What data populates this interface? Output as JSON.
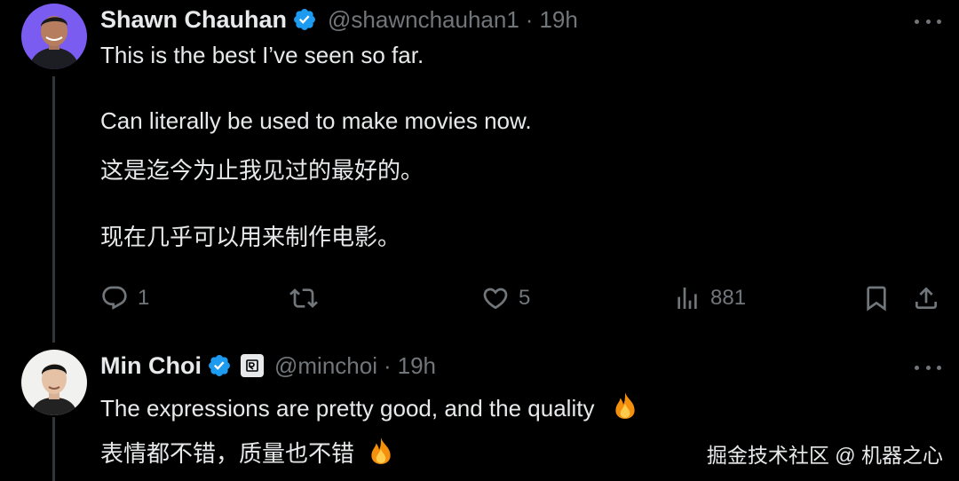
{
  "tweets": [
    {
      "author": "Shawn Chauhan",
      "handle": "@shawnchauhan1",
      "separator": "·",
      "time": "19h",
      "lines": [
        "This is the best I’ve seen so far.",
        "Can literally be used to make movies now.",
        "这是迄今为止我见过的最好的。",
        "现在几乎可以用来制作电影。"
      ],
      "stats": {
        "replies": "1",
        "likes": "5",
        "views": "881"
      }
    },
    {
      "author": "Min Choi",
      "handle": "@minchoi",
      "separator": "·",
      "time": "19h",
      "lines": [
        "The expressions are pretty good, and the quality",
        "表情都不错，质量也不错"
      ]
    }
  ],
  "watermark": "掘金技术社区 @ 机器之心",
  "colors": {
    "background": "#000000",
    "text": "#e7e9ea",
    "muted": "#71767b",
    "verified": "#1d9bf0",
    "thread_line": "#333639"
  }
}
